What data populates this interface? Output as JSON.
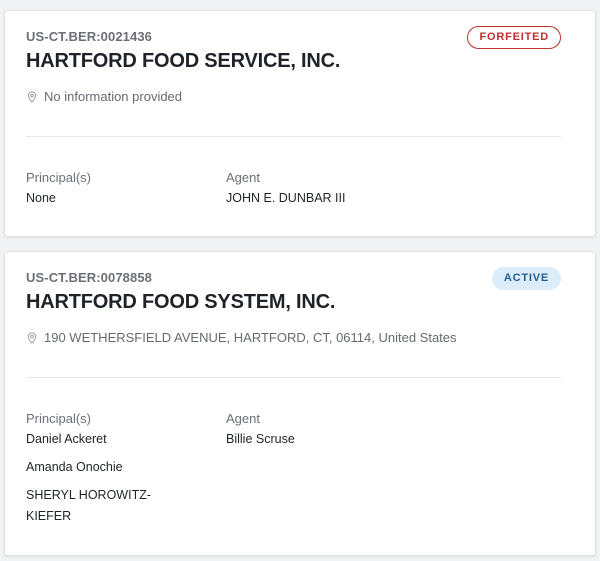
{
  "cards": [
    {
      "registration_id": "US-CT.BER:0021436",
      "status": "FORFEITED",
      "name": "HARTFORD FOOD SERVICE, INC.",
      "address": "No information provided",
      "principals_label": "Principal(s)",
      "principals": [
        "None"
      ],
      "agent_label": "Agent",
      "agent": "JOHN E. DUNBAR III",
      "icon": "location-pin-icon"
    },
    {
      "registration_id": "US-CT.BER:0078858",
      "status": "ACTIVE",
      "name": "HARTFORD FOOD SYSTEM, INC.",
      "address": "190 WETHERSFIELD AVENUE, HARTFORD, CT, 06114, United States",
      "principals_label": "Principal(s)",
      "principals": [
        "Daniel Ackeret",
        "Amanda Onochie",
        "SHERYL HOROWITZ-KIEFER"
      ],
      "agent_label": "Agent",
      "agent": "Billie Scruse",
      "icon": "location-pin-icon"
    }
  ],
  "colors": {
    "forfeited": "#c0302f",
    "active_text": "#1f5f92",
    "active_bg": "#dcedf9"
  }
}
